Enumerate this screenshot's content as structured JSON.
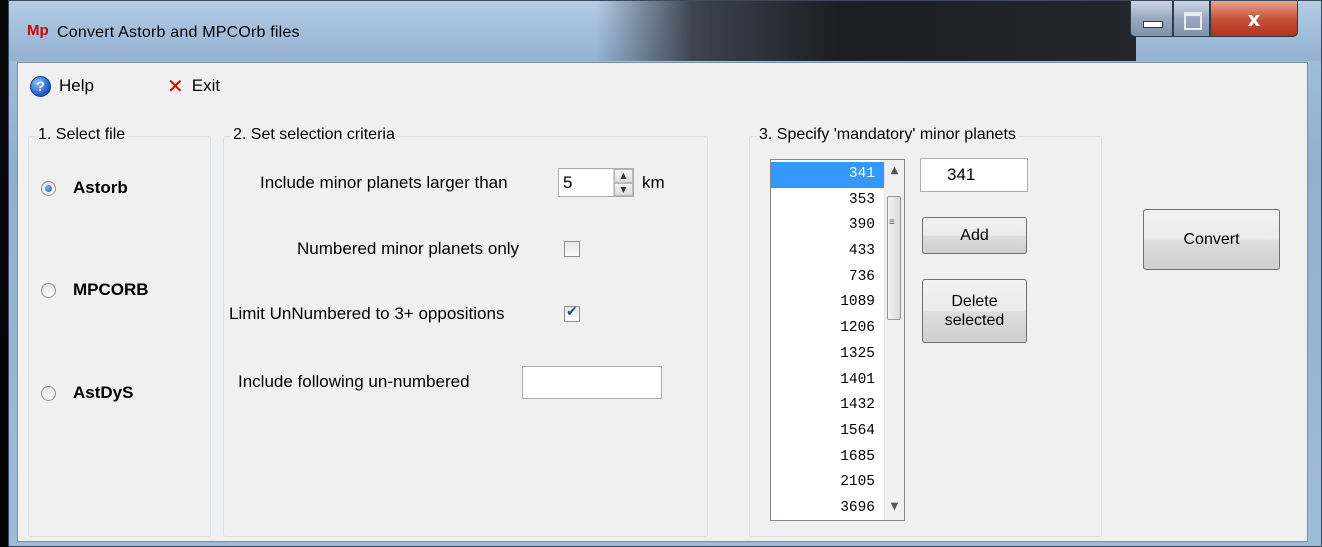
{
  "window": {
    "logo": "Mp",
    "title": "Convert  Astorb  and  MPCOrb  files",
    "controls": {
      "minimize": "minimize",
      "maximize": "maximize",
      "close": "x"
    }
  },
  "menu": {
    "help": {
      "label": "Help",
      "icon": "help-icon"
    },
    "exit": {
      "label": "Exit",
      "icon": "close-icon"
    }
  },
  "file_group": {
    "title": "1. Select file",
    "options": [
      {
        "label": "Astorb",
        "selected": true
      },
      {
        "label": "MPCORB",
        "selected": false
      },
      {
        "label": "AstDyS",
        "selected": false
      }
    ]
  },
  "criteria_group": {
    "title": "2. Set selection criteria",
    "size_label": "Include minor planets larger than",
    "size_value": "5",
    "size_unit": "km",
    "numbered_only_label": "Numbered minor planets only",
    "numbered_only_checked": false,
    "limit_unnumbered_label": "Limit UnNumbered to 3+ oppositions",
    "limit_unnumbered_checked": true,
    "include_unnumbered_label": "Include following un-numbered",
    "include_unnumbered_value": ""
  },
  "mandatory_group": {
    "title": "3. Specify 'mandatory' minor planets",
    "list": [
      "341",
      "353",
      "390",
      "433",
      "736",
      "1089",
      "1206",
      "1325",
      "1401",
      "1432",
      "1564",
      "1685",
      "2105",
      "3696"
    ],
    "selected_item": "341",
    "entry_value": "341",
    "add_label": "Add",
    "delete_label_line1": "Delete",
    "delete_label_line2": "selected"
  },
  "convert_label": "Convert",
  "colors": {
    "selection": "#3399ff",
    "exit_red": "#e00000",
    "logo_red": "#d40000"
  }
}
